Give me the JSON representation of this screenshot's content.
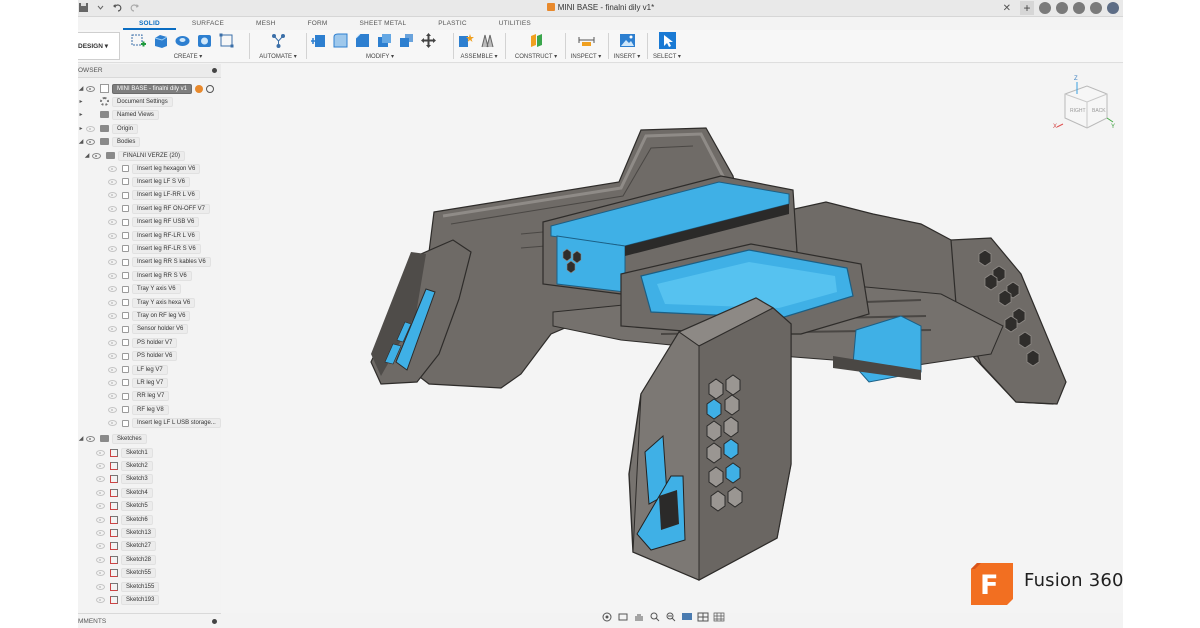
{
  "window": {
    "title": "MINI BASE - finalni dily v1*"
  },
  "tabs": [
    {
      "label": "SOLID"
    },
    {
      "label": "SURFACE"
    },
    {
      "label": "MESH"
    },
    {
      "label": "FORM"
    },
    {
      "label": "SHEET METAL"
    },
    {
      "label": "PLASTIC"
    },
    {
      "label": "UTILITIES"
    }
  ],
  "toolbar": {
    "design_label": "DESIGN ▾",
    "groups": [
      {
        "label": "CREATE ▾"
      },
      {
        "label": "AUTOMATE ▾"
      },
      {
        "label": "MODIFY ▾"
      },
      {
        "label": "ASSEMBLE ▾"
      },
      {
        "label": "CONSTRUCT ▾"
      },
      {
        "label": "INSPECT ▾"
      },
      {
        "label": "INSERT ▾"
      },
      {
        "label": "SELECT ▾"
      }
    ]
  },
  "browser": {
    "header": "OWSER",
    "root": "MINI BASE - finalni dily v1",
    "document_settings": "Document Settings",
    "named_views": "Named Views",
    "origin": "Origin",
    "bodies": "Bodies",
    "folder": "FINALNI VERZE (20)",
    "body_items": [
      "Insert leg hexagon V6",
      "Insert leg LF S V6",
      "Insert leg LF-RR L V6",
      "Insert leg RF ON-OFF V7",
      "Insert leg RF USB V6",
      "Insert leg RF-LR L V6",
      "Insert leg RF-LR S V6",
      "Insert leg RR S  kables V6",
      "Insert leg RR S V6",
      "Tray Y axis V6",
      "Tray Y axis hexa V6",
      "Tray on RF leg V6",
      "Sensor holder V6",
      "PS holder V7",
      "PS holder V6",
      "LF leg V7",
      "LR leg V7",
      "RR leg V7",
      "RF leg V8",
      "Insert leg LF L USB storage..."
    ],
    "sketches": "Sketches",
    "sketch_items": [
      "Sketch1",
      "Sketch2",
      "Sketch3",
      "Sketch4",
      "Sketch5",
      "Sketch6",
      "Sketch13",
      "Sketch27",
      "Sketch28",
      "Sketch55",
      "Sketch155",
      "Sketch193"
    ]
  },
  "comments": {
    "label": "MMENTS"
  },
  "viewcube": {
    "right": "RIGHT",
    "back": "BACK",
    "z": "Z",
    "x": "X",
    "y": "Y"
  },
  "brand": {
    "logo_letter": "F",
    "name": "Fusion 360"
  },
  "colors": {
    "accent_blue": "#0a6dc2",
    "model_gray": "#6e6a66",
    "model_dark": "#4a4744",
    "model_light": "#8c8884",
    "insert_blue": "#3fb0e6",
    "brand_orange": "#f26f21"
  }
}
